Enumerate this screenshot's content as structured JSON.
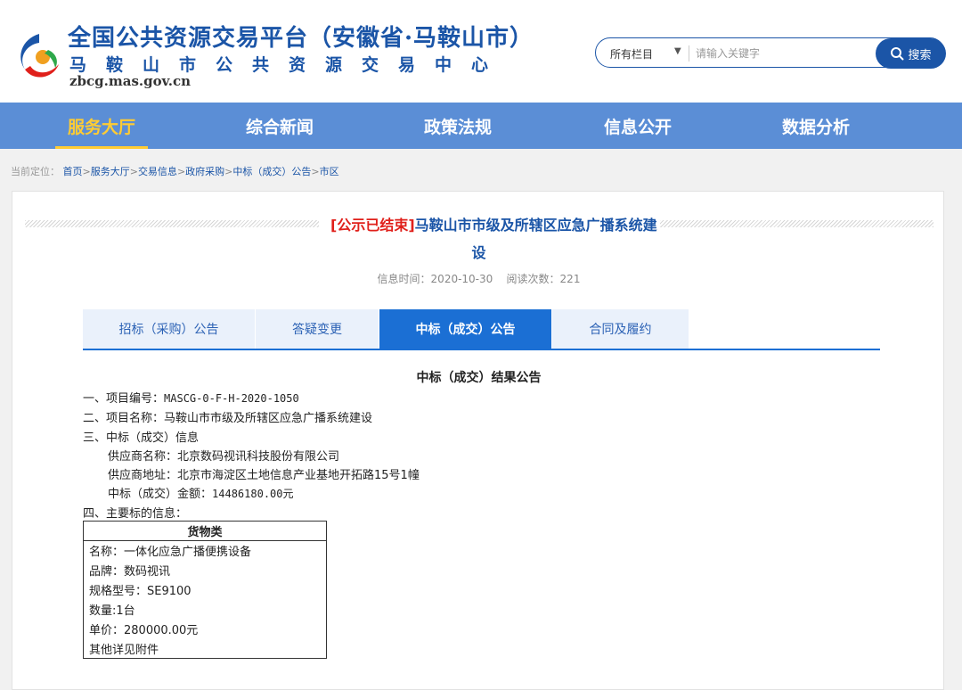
{
  "header": {
    "title": "全国公共资源交易平台（安徽省·马鞍山市）",
    "subtitle": "马鞍山市公共资源交易中心",
    "url": "zbcg.mas.gov.cn",
    "logo_icon": "ma-anshan-logo-icon"
  },
  "search": {
    "category": "所有栏目",
    "placeholder": "请输入关键字",
    "button_label": "搜索"
  },
  "nav": {
    "items": [
      {
        "label": "服务大厅",
        "active": true
      },
      {
        "label": "综合新闻"
      },
      {
        "label": "政策法规"
      },
      {
        "label": "信息公开"
      },
      {
        "label": "数据分析"
      }
    ]
  },
  "breadcrumb": {
    "prefix": "当前定位：",
    "items": [
      "首页",
      "服务大厅",
      "交易信息",
      "政府采购",
      "中标（成交）公告",
      "市区"
    ],
    "separator": ">"
  },
  "article": {
    "status_tag": "[公示已结束]",
    "title_main": "马鞍山市市级及所辖区应急广播系统建",
    "title_cont": "设",
    "meta": "信息时间：2020-10-30    阅读次数：221"
  },
  "tabs": [
    {
      "label": "招标（采购）公告"
    },
    {
      "label": "答疑变更"
    },
    {
      "label": "中标（成交）公告",
      "active": true
    },
    {
      "label": "合同及履约"
    }
  ],
  "doc": {
    "heading": "中标（成交）结果公告",
    "item1_label": "一、项目编号：",
    "item1_value": "MASCG-0-F-H-2020-1050",
    "item2_label": "二、项目名称：",
    "item2_value": "马鞍山市市级及所辖区应急广播系统建设",
    "item3_label": "三、中标（成交）信息",
    "supplier_name_label": "供应商名称：",
    "supplier_name": "北京数码视讯科技股份有限公司",
    "supplier_addr_label": "供应商地址：",
    "supplier_addr": "北京市海淀区土地信息产业基地开拓路15号1幢",
    "amount_label": "中标（成交）金额：",
    "amount": "14486180.00元",
    "item4_label": "四、主要标的信息：",
    "goods": {
      "header": "货物类",
      "rows": [
        "名称：一体化应急广播便携设备",
        "品牌：数码视讯",
        "规格型号：SE9100",
        "数量:1台",
        "单价：280000.00元",
        "其他详见附件"
      ]
    }
  },
  "colors": {
    "brand": "#1b55a7",
    "nav_bg": "#5b8ed6",
    "nav_active": "#ffcc33",
    "tab_active": "#1b6fd4",
    "tag_red": "#e0201b"
  }
}
